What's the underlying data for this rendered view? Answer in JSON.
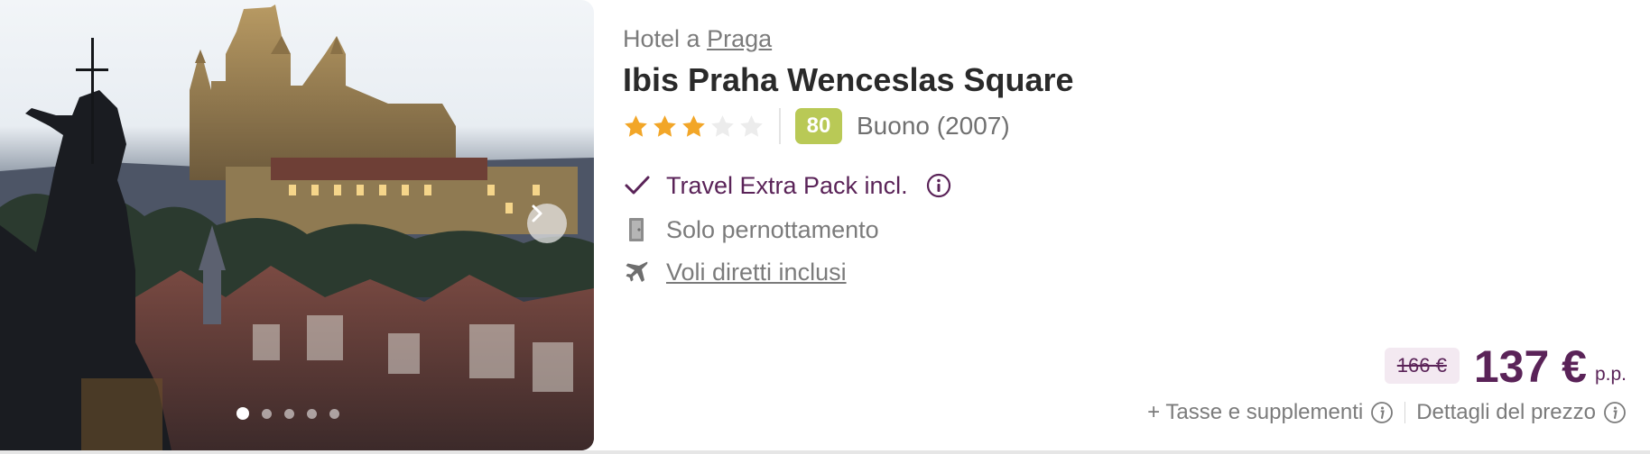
{
  "hotel": {
    "location_prefix": "Hotel a",
    "location_city": "Praga",
    "name": "Ibis Praha Wenceslas Square",
    "stars_filled": 3,
    "stars_total": 5,
    "score": "80",
    "review_text": "Buono (2007)"
  },
  "gallery": {
    "image_alt": "Prague Castle at dusk",
    "slide_count": 5,
    "active_slide": 1
  },
  "features": [
    {
      "label": "Travel Extra Pack incl.",
      "icon": "checkmark-icon"
    },
    {
      "label": "Solo pernottamento",
      "icon": "door-icon"
    },
    {
      "label": "Voli diretti inclusi",
      "icon": "plane-icon"
    }
  ],
  "price": {
    "old": "166 €",
    "current": "137 €",
    "per_person": "p.p.",
    "taxes_label": "+ Tasse e supplementi",
    "details_label": "Dettagli del prezzo"
  },
  "colors": {
    "brand_purple": "#5a2358",
    "score_badge": "#b9c956",
    "star_filled": "#f2a628",
    "star_empty": "#e6e6e6"
  }
}
